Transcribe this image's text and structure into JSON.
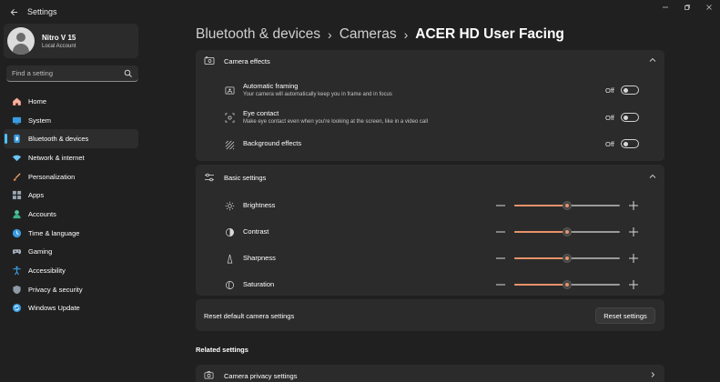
{
  "window": {
    "title": "Settings",
    "controls": [
      "minimize",
      "maximize",
      "close"
    ]
  },
  "profile": {
    "name": "Nitro V 15",
    "account_type": "Local Account"
  },
  "search": {
    "placeholder": "Find a setting"
  },
  "sidebar": {
    "items": [
      {
        "label": "Home",
        "icon": "home-icon",
        "active": false
      },
      {
        "label": "System",
        "icon": "monitor-icon",
        "active": false
      },
      {
        "label": "Bluetooth & devices",
        "icon": "bluetooth-icon",
        "active": true
      },
      {
        "label": "Network & internet",
        "icon": "wifi-icon",
        "active": false
      },
      {
        "label": "Personalization",
        "icon": "brush-icon",
        "active": false
      },
      {
        "label": "Apps",
        "icon": "apps-icon",
        "active": false
      },
      {
        "label": "Accounts",
        "icon": "person-icon",
        "active": false
      },
      {
        "label": "Time & language",
        "icon": "globe-clock-icon",
        "active": false
      },
      {
        "label": "Gaming",
        "icon": "gamepad-icon",
        "active": false
      },
      {
        "label": "Accessibility",
        "icon": "accessibility-icon",
        "active": false
      },
      {
        "label": "Privacy & security",
        "icon": "shield-icon",
        "active": false
      },
      {
        "label": "Windows Update",
        "icon": "update-icon",
        "active": false
      }
    ],
    "accent_color": "#4cc2ff"
  },
  "breadcrumb": {
    "items": [
      "Bluetooth & devices",
      "Cameras"
    ],
    "current": "ACER HD User Facing"
  },
  "camera_effects": {
    "title": "Camera effects",
    "expanded": true,
    "items": [
      {
        "title": "Automatic framing",
        "subtitle": "Your camera will automatically keep you in frame and in focus",
        "state": "Off",
        "icon": "framing-icon"
      },
      {
        "title": "Eye contact",
        "subtitle": "Make eye contact even when you're looking at the screen, like in a video call",
        "state": "Off",
        "icon": "eye-contact-icon"
      },
      {
        "title": "Background effects",
        "subtitle": "",
        "state": "Off",
        "icon": "background-effects-icon"
      }
    ]
  },
  "basic_settings": {
    "title": "Basic settings",
    "expanded": true,
    "sliders": [
      {
        "label": "Brightness",
        "value": 0.5,
        "icon": "brightness-icon"
      },
      {
        "label": "Contrast",
        "value": 0.5,
        "icon": "contrast-icon"
      },
      {
        "label": "Sharpness",
        "value": 0.5,
        "icon": "sharpness-icon"
      },
      {
        "label": "Saturation",
        "value": 0.5,
        "icon": "saturation-icon"
      }
    ],
    "slider_color": "#e8926a"
  },
  "reset": {
    "label": "Reset default camera settings",
    "button": "Reset settings"
  },
  "related": {
    "heading": "Related settings",
    "items": [
      {
        "label": "Camera privacy settings",
        "icon": "camera-icon"
      }
    ]
  }
}
